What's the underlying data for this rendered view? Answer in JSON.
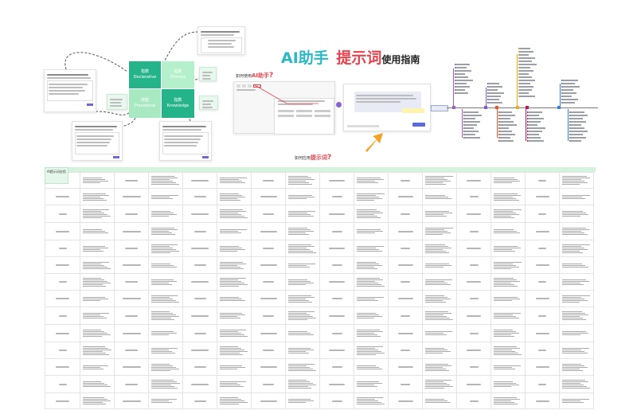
{
  "header": {
    "title_part1": "AI助手",
    "title_part2": "提示词",
    "title_part3": "使用指南"
  },
  "annotations": {
    "question1": "如何使用AI助手",
    "question1_ai": "AI助手",
    "question2_prefix": "如何应用",
    "question2_highlight": "提示词",
    "question_mark": "?"
  },
  "matrix": {
    "q1_line1": "指数",
    "q1_line2": "Declarative",
    "q2_line1": "指数",
    "q2_line2": "Process",
    "q3_line1": "技能",
    "q3_line2": "Procedural",
    "q4_line1": "指数",
    "q4_line2": "Knowledge"
  },
  "sheet": {
    "corner_label": "AI提示词应用"
  },
  "colors": {
    "green_dark": "#25b48a",
    "green_light": "#a8e9c2",
    "teal_title": "#2bb8c6",
    "red_title": "#e8434d",
    "orange_arrow": "#f4a12a",
    "header_row": "#d5f2df"
  },
  "mindmap": {
    "branch_colors": [
      "#a05fc8",
      "#7b5bd6",
      "#e5572f",
      "#f5a623",
      "#c2185b",
      "#3f7fd6"
    ]
  }
}
